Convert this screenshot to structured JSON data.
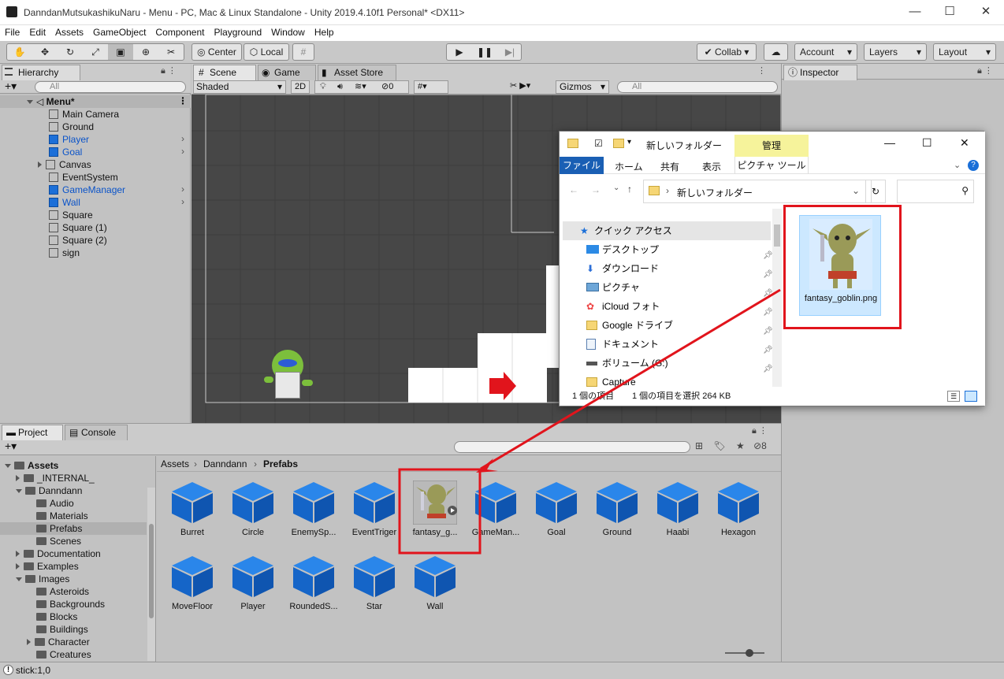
{
  "window": {
    "title": "DanndanMutsukashikuNaru - Menu - PC, Mac & Linux Standalone - Unity 2019.4.10f1 Personal* <DX11>",
    "minimize": "—",
    "maximize": "☐",
    "close": "✕"
  },
  "menu": [
    "File",
    "Edit",
    "Assets",
    "GameObject",
    "Component",
    "Playground",
    "Window",
    "Help"
  ],
  "toolbar": {
    "center_label": "Center",
    "local_label": "Local",
    "collab_label": "Collab",
    "account_label": "Account",
    "layers_label": "Layers",
    "layout_label": "Layout"
  },
  "hierarchy": {
    "tab": "Hierarchy",
    "search_placeholder": "All",
    "scene_name": "Menu*",
    "items": [
      {
        "label": "Main Camera",
        "prefab": false
      },
      {
        "label": "Ground",
        "prefab": false
      },
      {
        "label": "Player",
        "prefab": true
      },
      {
        "label": "Goal",
        "prefab": true
      },
      {
        "label": "Canvas",
        "prefab": false
      },
      {
        "label": "EventSystem",
        "prefab": false
      },
      {
        "label": "GameManager",
        "prefab": true
      },
      {
        "label": "Wall",
        "prefab": true
      },
      {
        "label": "Square",
        "prefab": false
      },
      {
        "label": "Square (1)",
        "prefab": false
      },
      {
        "label": "Square (2)",
        "prefab": false
      },
      {
        "label": "sign",
        "prefab": false
      }
    ]
  },
  "scene": {
    "tabs": [
      "Scene",
      "Game",
      "Asset Store"
    ],
    "shading": "Shaded",
    "mode_2d": "2D",
    "hidden_count": "0",
    "gizmos_label": "Gizmos",
    "search_placeholder": "All"
  },
  "inspector": {
    "tab": "Inspector"
  },
  "project": {
    "tabs": [
      "Project",
      "Console"
    ],
    "breadcrumb": [
      "Assets",
      "Danndann",
      "Prefabs"
    ],
    "hidden_count": "8",
    "tree": [
      {
        "label": "Assets",
        "level": 0,
        "expanded": true
      },
      {
        "label": "_INTERNAL_",
        "level": 1,
        "expanded": false
      },
      {
        "label": "Danndann",
        "level": 1,
        "expanded": true
      },
      {
        "label": "Audio",
        "level": 2
      },
      {
        "label": "Materials",
        "level": 2
      },
      {
        "label": "Prefabs",
        "level": 2,
        "selected": true
      },
      {
        "label": "Scenes",
        "level": 2
      },
      {
        "label": "Documentation",
        "level": 1,
        "expanded": false
      },
      {
        "label": "Examples",
        "level": 1,
        "expanded": false
      },
      {
        "label": "Images",
        "level": 1,
        "expanded": true
      },
      {
        "label": "Asteroids",
        "level": 2
      },
      {
        "label": "Backgrounds",
        "level": 2
      },
      {
        "label": "Blocks",
        "level": 2
      },
      {
        "label": "Buildings",
        "level": 2
      },
      {
        "label": "Character",
        "level": 2,
        "expanded": false
      },
      {
        "label": "Creatures",
        "level": 2
      }
    ],
    "assets_row1": [
      "Burret",
      "Circle",
      "EnemySp...",
      "EventTriger",
      "fantasy_g...",
      "GameMan...",
      "Goal",
      "Ground",
      "Haabi",
      "Hexagon"
    ],
    "assets_row2": [
      "MoveFloor",
      "Player",
      "RoundedS...",
      "Star",
      "Wall"
    ]
  },
  "explorer": {
    "title": "新しいフォルダー",
    "manage_tab": "管理",
    "ribbon_tabs": [
      "ファイル",
      "ホーム",
      "共有",
      "表示",
      "ピクチャ ツール"
    ],
    "address": "新しいフォルダー",
    "nav": [
      "クイック アクセス",
      "デスクトップ",
      "ダウンロード",
      "ピクチャ",
      "iCloud フォト",
      "Google ドライブ",
      "ドキュメント",
      "ボリューム (G:)",
      "Capture"
    ],
    "file_name": "fantasy_goblin.png",
    "status_items": "1 個の項目",
    "status_selected": "1 個の項目を選択  264 KB"
  },
  "status": {
    "text": "stick:1,0"
  },
  "colors": {
    "accent_red": "#e1141c",
    "prefab_blue": "#1c6fd8",
    "selection": "#cce8ff"
  }
}
